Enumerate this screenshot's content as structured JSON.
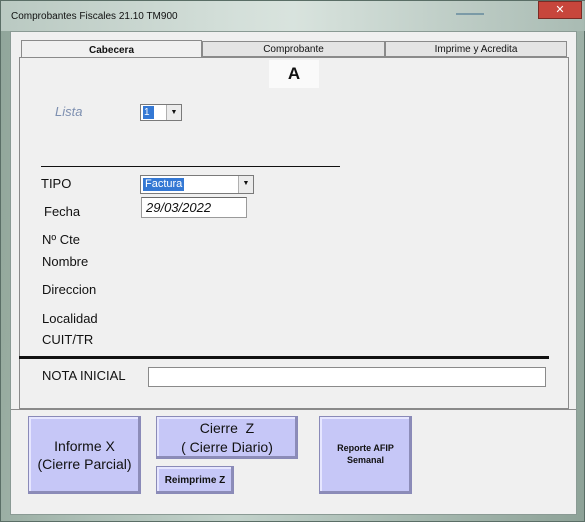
{
  "window": {
    "title": "Comprobantes Fiscales 21.10  TM900",
    "close_glyph": "✕"
  },
  "tabs": [
    {
      "label": "Cabecera",
      "active": true
    },
    {
      "label": "Comprobante",
      "active": false
    },
    {
      "label": "Imprime y Acredita",
      "active": false
    }
  ],
  "header": {
    "letter": "A"
  },
  "lista": {
    "label": "Lista",
    "value": "1"
  },
  "fields": {
    "tipo_label": "TIPO",
    "tipo_value": "Factura",
    "fecha_label": "Fecha",
    "fecha_value": "29/03/2022",
    "cte_label": "Nº Cte",
    "nombre_label": "Nombre",
    "direccion_label": "Direccion",
    "localidad_label": "Localidad",
    "cuit_label": "CUIT/TR",
    "nota_label": "NOTA INICIAL",
    "nota_value": ""
  },
  "buttons": {
    "informe_x": "Informe X\n(Cierre Parcial)",
    "cierre_z": "Cierre  Z\n( Cierre Diario)",
    "reimprime_z": "Reimprime Z",
    "reporte_afip": "Reporte AFIP\nSemanal"
  },
  "colors": {
    "button_bg": "#c6c7f7",
    "selection": "#3478d4",
    "close": "#c7463c"
  }
}
